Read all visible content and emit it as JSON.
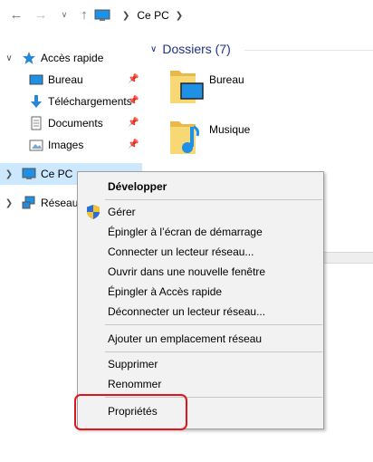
{
  "window": {
    "address": {
      "location_label": "Ce PC"
    }
  },
  "sidebar": {
    "quick_access": "Accès rapide",
    "items": [
      {
        "label": "Bureau"
      },
      {
        "label": "Téléchargements"
      },
      {
        "label": "Documents"
      },
      {
        "label": "Images"
      }
    ],
    "this_pc": "Ce PC",
    "network": "Réseau"
  },
  "main": {
    "group_title": "Dossiers (7)",
    "folders": [
      {
        "label": "Bureau"
      },
      {
        "label": "Musique"
      }
    ]
  },
  "context_menu": {
    "items": [
      {
        "label": "Développer",
        "bold": true
      },
      {
        "label": "Gérer",
        "icon": "shield-icon"
      },
      {
        "label": "Épingler à l’écran de démarrage"
      },
      {
        "label": "Connecter un lecteur réseau..."
      },
      {
        "label": "Ouvrir dans une nouvelle fenêtre"
      },
      {
        "label": "Épingler à Accès rapide"
      },
      {
        "label": "Déconnecter un lecteur réseau..."
      },
      {
        "label": "Ajouter un emplacement réseau"
      },
      {
        "label": "Supprimer"
      },
      {
        "label": "Renommer"
      },
      {
        "label": "Propriétés"
      }
    ]
  },
  "colors": {
    "selection": "#cce8ff",
    "group_title": "#1e3287",
    "highlight": "#e0151b",
    "menu_bg": "#f2f2f2"
  }
}
